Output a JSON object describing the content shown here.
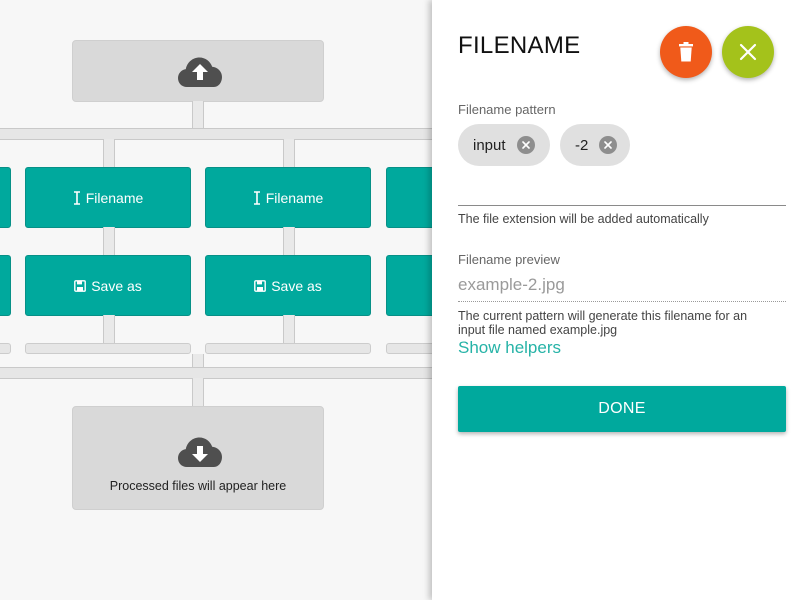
{
  "workflow": {
    "nodes": {
      "filename_label": "Filename",
      "save_as_label": "Save as"
    },
    "output": {
      "text": "Processed files will appear here"
    },
    "icons": {
      "input": "cloud-upload-icon",
      "output": "cloud-download-icon",
      "filename": "text-cursor-icon",
      "save": "floppy-disk-icon"
    }
  },
  "panel": {
    "title": "FILENAME",
    "pattern_label": "Filename pattern",
    "chips": [
      {
        "label": "input"
      },
      {
        "label": "-2"
      }
    ],
    "extension_hint": "The file extension will be added automatically",
    "preview_label": "Filename preview",
    "preview_value": "example-2.jpg",
    "preview_hint_line1": "The current pattern will generate this filename for an",
    "preview_hint_line2": "input file named example.jpg",
    "helpers_link": "Show helpers",
    "done_label": "DONE",
    "icons": {
      "delete": "trash-icon",
      "close": "close-icon",
      "chip_remove": "remove-circle-icon"
    }
  },
  "colors": {
    "teal": "#00a99d",
    "link_teal": "#26b3a7",
    "delete_orange": "#f05a1a",
    "close_green": "#a4c21b"
  }
}
